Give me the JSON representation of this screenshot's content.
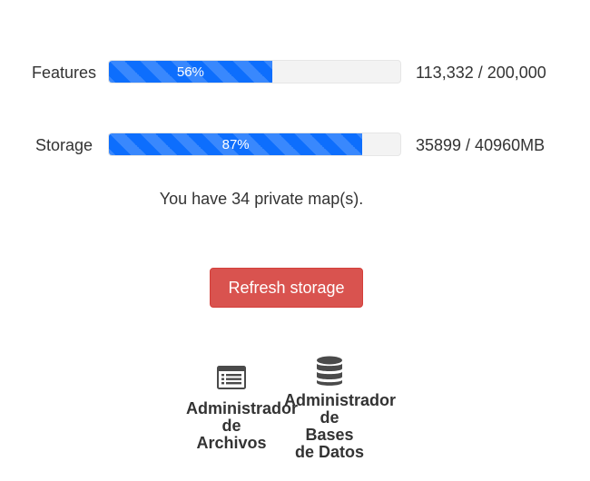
{
  "quotas": {
    "features": {
      "label": "Features",
      "percent_text": "56%",
      "fill": 0.56,
      "value_text": "113,332 / 200,000"
    },
    "storage": {
      "label": "Storage",
      "percent_text": "87%",
      "fill": 0.87,
      "value_text": "35899 / 40960MB"
    }
  },
  "maps_note": "You have 34 private map(s).",
  "refresh_button": {
    "label": "Refresh storage",
    "color": "#d9534f"
  },
  "progress_color": "#0d6efd",
  "tools": [
    {
      "label": "Administrador\nde\nArchivos",
      "icon": "file-list-icon"
    },
    {
      "label": "Administrador\nde\nBases\nde Datos",
      "icon": "database-icon"
    }
  ]
}
